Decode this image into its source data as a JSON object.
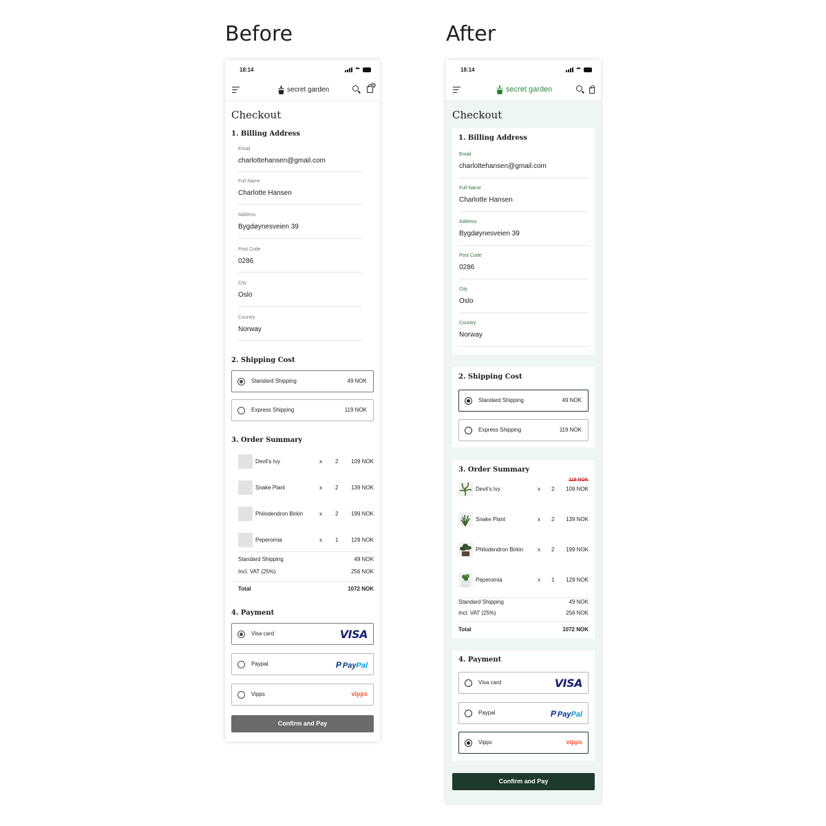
{
  "labels": {
    "before": "Before",
    "after": "After"
  },
  "status": {
    "time": "18:14"
  },
  "brand": {
    "name": "secret garden",
    "cart_count": "1"
  },
  "checkout": {
    "title": "Checkout",
    "billing": {
      "title": "1. Billing Address",
      "fields": [
        {
          "label": "Email",
          "value": "charlottehansen@gmail.com"
        },
        {
          "label": "Full Name",
          "value": "Charlotte Hansen"
        },
        {
          "label": "Address",
          "value": "Bygdøynesveien 39"
        },
        {
          "label": "Post Code",
          "value": "0286"
        },
        {
          "label": "City",
          "value": "Oslo"
        },
        {
          "label": "Country",
          "value": "Norway"
        }
      ]
    },
    "shipping": {
      "title": "2. Shipping Cost",
      "options": [
        {
          "label": "Standard Shipping",
          "price": "49 NOK"
        },
        {
          "label": "Express Shipping",
          "price": "119 NOK"
        }
      ]
    },
    "summary": {
      "title": "3. Order Summary",
      "items": [
        {
          "name": "Devil’s Ivy",
          "x": "x",
          "qty": "2",
          "price": "109 NOK",
          "old_price": "119 NOK"
        },
        {
          "name": "Snake Plant",
          "x": "x",
          "qty": "2",
          "price": "139 NOK"
        },
        {
          "name": "Philodendron Birkin",
          "x": "x",
          "qty": "2",
          "price": "199 NOK"
        },
        {
          "name": "Peperomia",
          "x": "x",
          "qty": "1",
          "price": "129 NOK"
        }
      ],
      "shipping_label": "Standard Shipping",
      "shipping_value": "49 NOK",
      "vat_label": "Incl. VAT (25%)",
      "vat_value": "256 NOK",
      "total_label": "Total",
      "total_value": "1072 NOK"
    },
    "payment": {
      "title": "4. Payment",
      "options": [
        {
          "label": "Visa card",
          "logo": "VISA"
        },
        {
          "label": "Paypal",
          "logo_a": "Pay",
          "logo_b": "Pal",
          "logo_mark": "P"
        },
        {
          "label": "Vipps",
          "logo": "vipps"
        }
      ]
    },
    "cta": "Confirm and Pay"
  },
  "colors": {
    "before_cta": "#6b6b6b",
    "after_cta": "#1e3a2c",
    "after_bg": "#eef6f1",
    "brand_green": "#2f8a3a"
  },
  "icons": {
    "menu": "hamburger-icon",
    "search": "search-icon",
    "cart": "bag-icon",
    "logo": "plant-pot-icon"
  }
}
